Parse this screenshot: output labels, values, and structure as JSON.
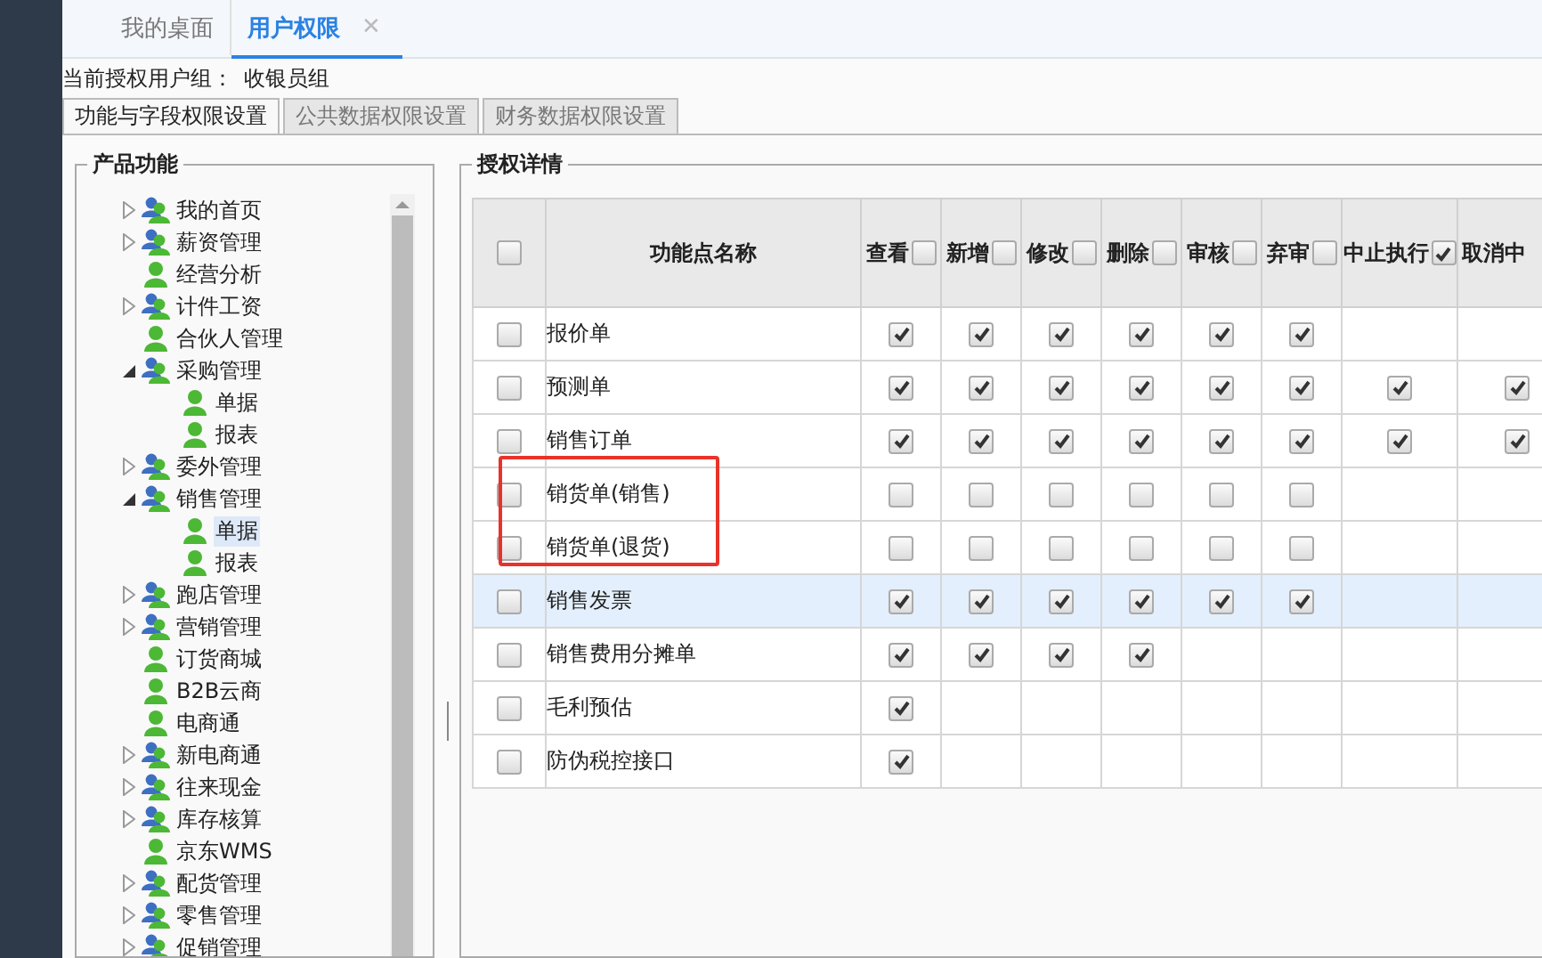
{
  "tabs": [
    {
      "label": "我的桌面",
      "selected": false
    },
    {
      "label": "用户权限",
      "selected": true,
      "close": "✕"
    }
  ],
  "user_group": {
    "label": "当前授权用户组：",
    "value": "收银员组"
  },
  "sub_tabs": [
    {
      "label": "功能与字段权限设置",
      "selected": true
    },
    {
      "label": "公共数据权限设置",
      "selected": false
    },
    {
      "label": "财务数据权限设置",
      "selected": false
    }
  ],
  "tree": {
    "title": "产品功能",
    "items": [
      {
        "label": "我的首页",
        "kind": "group",
        "expanded": false,
        "selected": false
      },
      {
        "label": "薪资管理",
        "kind": "group",
        "expanded": false,
        "selected": false
      },
      {
        "label": "经营分析",
        "kind": "user",
        "selected": false
      },
      {
        "label": "计件工资",
        "kind": "group",
        "expanded": false,
        "selected": false
      },
      {
        "label": "合伙人管理",
        "kind": "user",
        "selected": false
      },
      {
        "label": "采购管理",
        "kind": "group",
        "expanded": true,
        "selected": false,
        "children": [
          {
            "label": "单据",
            "kind": "user",
            "selected": false
          },
          {
            "label": "报表",
            "kind": "user",
            "selected": false
          }
        ]
      },
      {
        "label": "委外管理",
        "kind": "group",
        "expanded": false,
        "selected": false
      },
      {
        "label": "销售管理",
        "kind": "group",
        "expanded": true,
        "selected": false,
        "children": [
          {
            "label": "单据",
            "kind": "user",
            "selected": true
          },
          {
            "label": "报表",
            "kind": "user",
            "selected": false
          }
        ]
      },
      {
        "label": "跑店管理",
        "kind": "group",
        "expanded": false,
        "selected": false
      },
      {
        "label": "营销管理",
        "kind": "group",
        "expanded": false,
        "selected": false
      },
      {
        "label": "订货商城",
        "kind": "user",
        "selected": false
      },
      {
        "label": "B2B云商",
        "kind": "user",
        "selected": false
      },
      {
        "label": "电商通",
        "kind": "user",
        "selected": false
      },
      {
        "label": "新电商通",
        "kind": "group",
        "expanded": false,
        "selected": false
      },
      {
        "label": "往来现金",
        "kind": "group",
        "expanded": false,
        "selected": false
      },
      {
        "label": "库存核算",
        "kind": "group",
        "expanded": false,
        "selected": false
      },
      {
        "label": "京东WMS",
        "kind": "user",
        "selected": false
      },
      {
        "label": "配货管理",
        "kind": "group",
        "expanded": false,
        "selected": false
      },
      {
        "label": "零售管理",
        "kind": "group",
        "expanded": false,
        "selected": false
      },
      {
        "label": "促销管理",
        "kind": "group",
        "expanded": false,
        "selected": false
      }
    ]
  },
  "details": {
    "title": "授权详情",
    "select_all_checked": false,
    "name_header": "功能点名称",
    "columns": [
      {
        "label": "查看",
        "checked": false
      },
      {
        "label": "新增",
        "checked": false
      },
      {
        "label": "修改",
        "checked": false
      },
      {
        "label": "删除",
        "checked": false
      },
      {
        "label": "审核",
        "checked": false
      },
      {
        "label": "弃审",
        "checked": false
      },
      {
        "label": "中止执行",
        "checked": true
      },
      {
        "label": "取消中"
      }
    ],
    "rows": [
      {
        "name": "报价单",
        "checked": false,
        "selected": false,
        "marked": false,
        "perms": [
          {
            "kind": "checkbox",
            "checked": true
          },
          {
            "kind": "checkbox",
            "checked": true
          },
          {
            "kind": "checkbox",
            "checked": true
          },
          {
            "kind": "checkbox",
            "checked": true
          },
          {
            "kind": "checkbox",
            "checked": true
          },
          {
            "kind": "checkbox",
            "checked": true
          },
          {
            "kind": "blank"
          },
          {
            "kind": "blank"
          }
        ]
      },
      {
        "name": "预测单",
        "checked": false,
        "selected": false,
        "marked": false,
        "perms": [
          {
            "kind": "checkbox",
            "checked": true
          },
          {
            "kind": "checkbox",
            "checked": true
          },
          {
            "kind": "checkbox",
            "checked": true
          },
          {
            "kind": "checkbox",
            "checked": true
          },
          {
            "kind": "checkbox",
            "checked": true
          },
          {
            "kind": "checkbox",
            "checked": true
          },
          {
            "kind": "checkbox",
            "checked": true
          },
          {
            "kind": "checkbox",
            "checked": true
          }
        ]
      },
      {
        "name": "销售订单",
        "checked": false,
        "selected": false,
        "marked": false,
        "perms": [
          {
            "kind": "checkbox",
            "checked": true
          },
          {
            "kind": "checkbox",
            "checked": true
          },
          {
            "kind": "checkbox",
            "checked": true
          },
          {
            "kind": "checkbox",
            "checked": true
          },
          {
            "kind": "checkbox",
            "checked": true
          },
          {
            "kind": "checkbox",
            "checked": true
          },
          {
            "kind": "checkbox",
            "checked": true
          },
          {
            "kind": "checkbox",
            "checked": true
          }
        ]
      },
      {
        "name": "销货单(销售)",
        "checked": false,
        "selected": false,
        "marked": true,
        "perms": [
          {
            "kind": "checkbox",
            "checked": false
          },
          {
            "kind": "checkbox",
            "checked": false
          },
          {
            "kind": "checkbox",
            "checked": false
          },
          {
            "kind": "checkbox",
            "checked": false
          },
          {
            "kind": "checkbox",
            "checked": false
          },
          {
            "kind": "checkbox",
            "checked": false
          },
          {
            "kind": "blank"
          },
          {
            "kind": "blank"
          }
        ]
      },
      {
        "name": "销货单(退货)",
        "checked": false,
        "selected": false,
        "marked": true,
        "perms": [
          {
            "kind": "checkbox",
            "checked": false
          },
          {
            "kind": "checkbox",
            "checked": false
          },
          {
            "kind": "checkbox",
            "checked": false
          },
          {
            "kind": "checkbox",
            "checked": false
          },
          {
            "kind": "checkbox",
            "checked": false
          },
          {
            "kind": "checkbox",
            "checked": false
          },
          {
            "kind": "blank"
          },
          {
            "kind": "blank"
          }
        ]
      },
      {
        "name": "销售发票",
        "checked": false,
        "selected": true,
        "marked": false,
        "perms": [
          {
            "kind": "checkbox",
            "checked": true
          },
          {
            "kind": "checkbox",
            "checked": true
          },
          {
            "kind": "checkbox",
            "checked": true
          },
          {
            "kind": "checkbox",
            "checked": true
          },
          {
            "kind": "checkbox",
            "checked": true
          },
          {
            "kind": "checkbox",
            "checked": true
          },
          {
            "kind": "blank"
          },
          {
            "kind": "blank"
          }
        ]
      },
      {
        "name": "销售费用分摊单",
        "checked": false,
        "selected": false,
        "marked": false,
        "perms": [
          {
            "kind": "checkbox",
            "checked": true
          },
          {
            "kind": "checkbox",
            "checked": true
          },
          {
            "kind": "checkbox",
            "checked": true
          },
          {
            "kind": "checkbox",
            "checked": true
          },
          {
            "kind": "blank"
          },
          {
            "kind": "blank"
          },
          {
            "kind": "blank"
          },
          {
            "kind": "blank"
          }
        ]
      },
      {
        "name": "毛利预估",
        "checked": false,
        "selected": false,
        "marked": false,
        "perms": [
          {
            "kind": "checkbox",
            "checked": true
          },
          {
            "kind": "blank"
          },
          {
            "kind": "blank"
          },
          {
            "kind": "blank"
          },
          {
            "kind": "blank"
          },
          {
            "kind": "blank"
          },
          {
            "kind": "blank"
          },
          {
            "kind": "blank"
          }
        ]
      },
      {
        "name": "防伪税控接口",
        "checked": false,
        "selected": false,
        "marked": false,
        "perms": [
          {
            "kind": "checkbox",
            "checked": true
          },
          {
            "kind": "blank"
          },
          {
            "kind": "blank"
          },
          {
            "kind": "blank"
          },
          {
            "kind": "blank"
          },
          {
            "kind": "blank"
          },
          {
            "kind": "blank"
          },
          {
            "kind": "blank"
          }
        ]
      }
    ]
  }
}
